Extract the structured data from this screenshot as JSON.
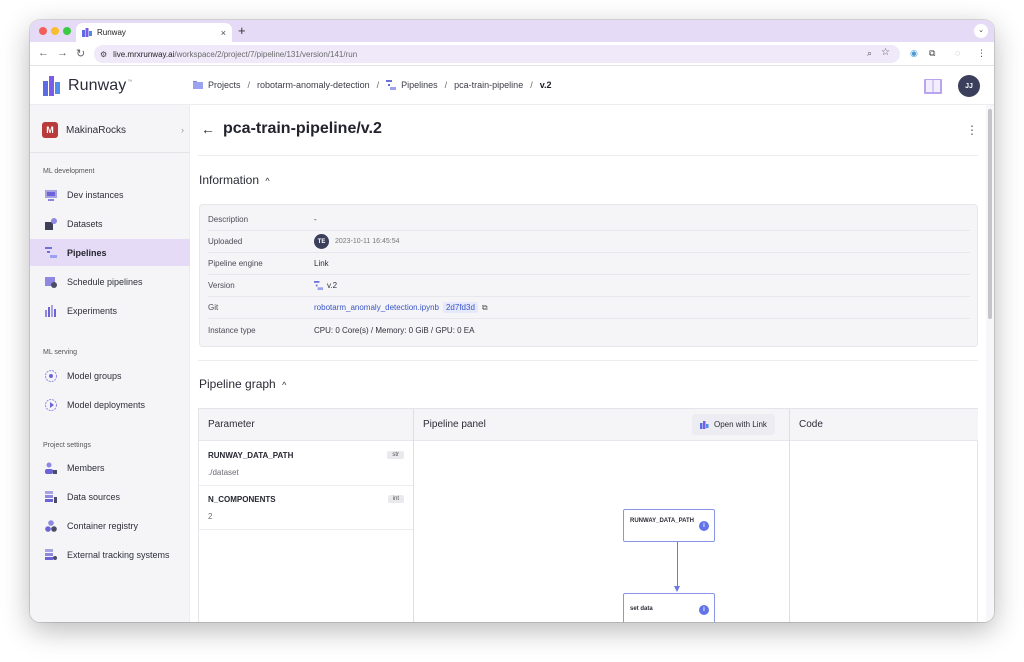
{
  "browser": {
    "tab_title": "Runway",
    "tab_close": "×",
    "new_tab": "+",
    "url_host": "live.mrxrunway.ai",
    "url_path": "/workspace/2/project/7/pipeline/131/version/141/run"
  },
  "header": {
    "logo_text": "Runway",
    "logo_tm": "™",
    "breadcrumb": {
      "projects": "Projects",
      "project": "robotarm-anomaly-detection",
      "pipelines": "Pipelines",
      "pipeline": "pca-train-pipeline",
      "version": "v.2",
      "separator": "/"
    },
    "avatar": "JJ"
  },
  "sidebar": {
    "org_initial": "M",
    "org_name": "MakinaRocks",
    "sections": {
      "ml_development": "ML development",
      "ml_serving": "ML serving",
      "project_settings": "Project settings"
    },
    "items": [
      {
        "label": "Dev instances",
        "icon": "monitor-icon"
      },
      {
        "label": "Datasets",
        "icon": "database-icon"
      },
      {
        "label": "Pipelines",
        "icon": "pipeline-icon"
      },
      {
        "label": "Schedule pipelines",
        "icon": "schedule-icon"
      },
      {
        "label": "Experiments",
        "icon": "chart-icon"
      },
      {
        "label": "Model groups",
        "icon": "model-group-icon"
      },
      {
        "label": "Model deployments",
        "icon": "deployment-icon"
      },
      {
        "label": "Members",
        "icon": "members-icon"
      },
      {
        "label": "Data sources",
        "icon": "data-source-icon"
      },
      {
        "label": "Container registry",
        "icon": "container-icon"
      },
      {
        "label": "External tracking systems",
        "icon": "tracking-icon"
      }
    ],
    "active_item": "Pipelines"
  },
  "main": {
    "title": "pca-train-pipeline/v.2",
    "information_heading": "Information",
    "information": {
      "description_label": "Description",
      "description_value": "-",
      "uploaded_label": "Uploaded",
      "uploaded_avatar": "TE",
      "uploaded_value": "2023-10-11 16:45:54",
      "engine_label": "Pipeline engine",
      "engine_value": "Link",
      "version_label": "Version",
      "version_value": "v.2",
      "git_label": "Git",
      "git_file": "robotarm_anomaly_detection.ipynb",
      "git_hash": "2d7fd3d",
      "instance_label": "Instance type",
      "instance_value": "CPU: 0 Core(s) / Memory: 0 GiB / GPU: 0 EA"
    },
    "graph_heading": "Pipeline graph",
    "graph": {
      "parameter_header": "Parameter",
      "panel_header": "Pipeline panel",
      "code_header": "Code",
      "open_with_link": "Open with Link",
      "parameters": [
        {
          "name": "RUNWAY_DATA_PATH",
          "type": "str",
          "value": "./dataset"
        },
        {
          "name": "N_COMPONENTS",
          "type": "int",
          "value": "2"
        }
      ],
      "nodes": [
        {
          "name": "RUNWAY_DATA_PATH"
        },
        {
          "name": "set data"
        }
      ]
    }
  },
  "colors": {
    "accent": "#6374e8",
    "active_nav": "#e6dbf6",
    "chrome_tab": "#e5dbf7",
    "org_badge": "#b83a3a"
  }
}
